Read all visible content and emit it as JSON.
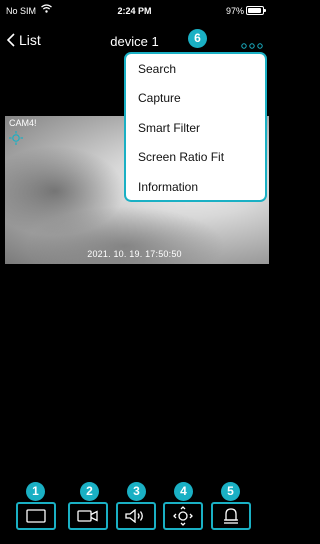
{
  "status_bar": {
    "carrier": "No SIM",
    "time": "2:24 PM",
    "battery": "97%"
  },
  "nav": {
    "back_label": "List",
    "title": "device 1"
  },
  "video": {
    "camera_label": "CAM4!",
    "timestamp": "2021. 10. 19. 17:50:50"
  },
  "menu": {
    "items": [
      {
        "label": "Search"
      },
      {
        "label": "Capture"
      },
      {
        "label": "Smart Filter"
      },
      {
        "label": "Screen Ratio Fit"
      },
      {
        "label": "Information"
      }
    ]
  },
  "badges": [
    "1",
    "2",
    "3",
    "4",
    "5",
    "6"
  ],
  "toolbar": {
    "buttons": [
      {
        "icon": "screen-layout-icon"
      },
      {
        "icon": "record-icon"
      },
      {
        "icon": "audio-icon"
      },
      {
        "icon": "ptz-icon"
      },
      {
        "icon": "alarm-bell-icon"
      }
    ]
  },
  "colors": {
    "accent": "#1ab0c4",
    "background": "#000000",
    "menu_background": "#ffffff"
  }
}
